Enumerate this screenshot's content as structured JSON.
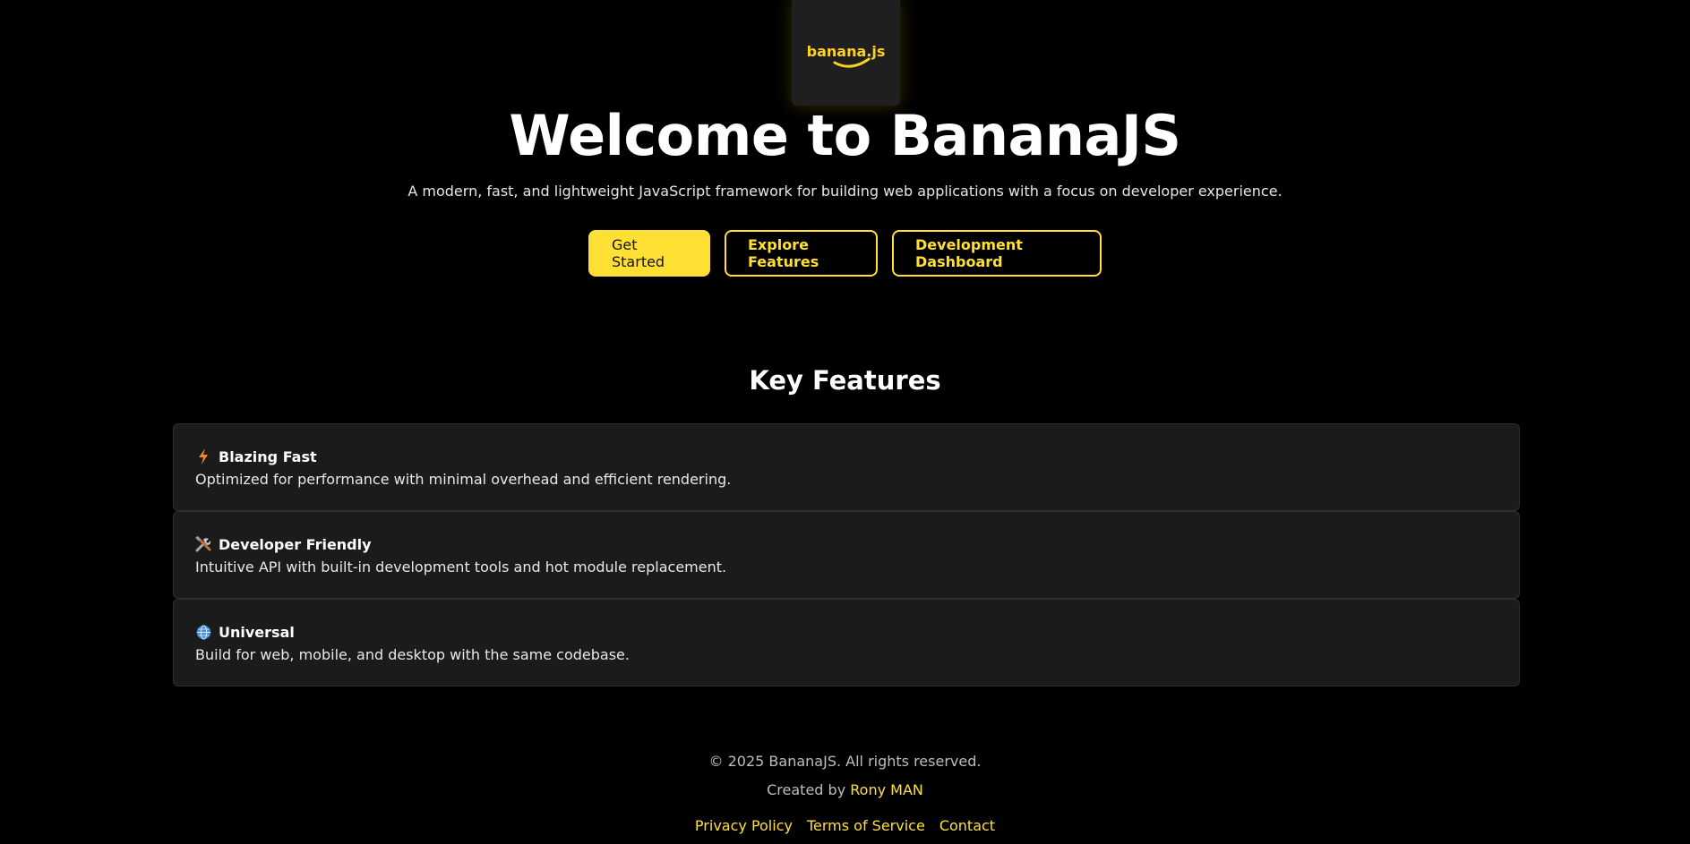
{
  "logo": {
    "text": "banana.js",
    "color": "#ffd21f"
  },
  "hero": {
    "title": "Welcome to BananaJS",
    "subtitle": "A modern, fast, and lightweight JavaScript framework for building web applications with a focus on developer experience."
  },
  "buttons": {
    "get_started": "Get Started",
    "explore_features": "Explore Features",
    "dev_dashboard": "Development Dashboard"
  },
  "features": {
    "heading": "Key Features",
    "items": [
      {
        "icon": "lightning-icon",
        "title": "Blazing Fast",
        "description": "Optimized for performance with minimal overhead and efficient rendering."
      },
      {
        "icon": "tools-icon",
        "title": "Developer Friendly",
        "description": "Intuitive API with built-in development tools and hot module replacement."
      },
      {
        "icon": "globe-icon",
        "title": "Universal",
        "description": "Build for web, mobile, and desktop with the same codebase."
      }
    ]
  },
  "footer": {
    "copyright": "© 2025 BananaJS. All rights reserved.",
    "created_by_prefix": "Created by",
    "author": "Rony MAN",
    "links": [
      "Privacy Policy",
      "Terms of Service",
      "Contact"
    ]
  },
  "colors": {
    "accent": "#ffe033",
    "background": "#000000",
    "card": "#1b1b1b"
  }
}
